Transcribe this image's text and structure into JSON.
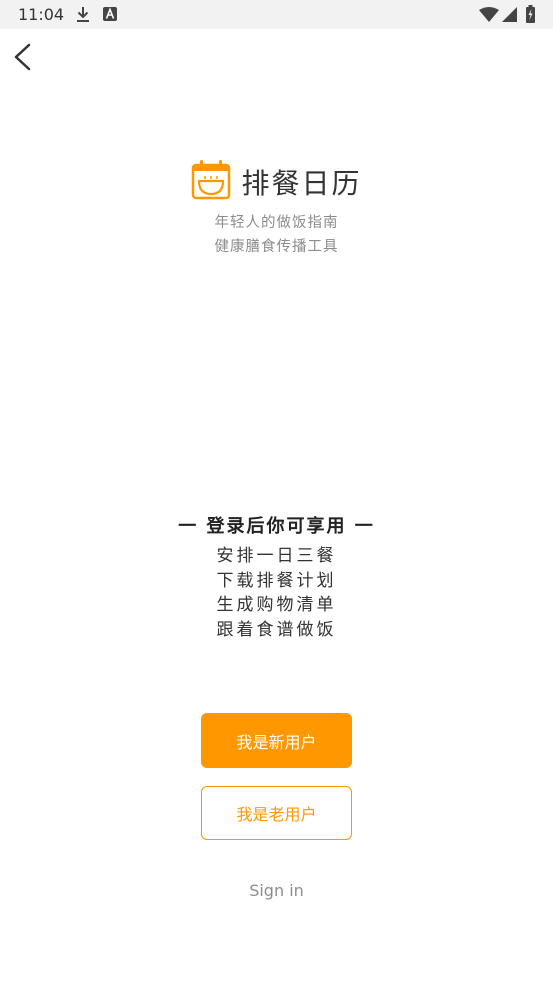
{
  "status_bar": {
    "time": "11:04",
    "left_icons": [
      "download-icon",
      "notification-a-icon"
    ],
    "right_icons": [
      "wifi-icon",
      "signal-icon",
      "battery-icon"
    ]
  },
  "header": {
    "back_icon": "chevron-left-icon"
  },
  "brand": {
    "logo_icon": "calendar-bowl-icon",
    "title": "排餐日历",
    "tagline_1": "年轻人的做饭指南",
    "tagline_2": "健康膳食传播工具"
  },
  "features": {
    "heading": "一 登录后你可享用 一",
    "items": [
      "安排一日三餐",
      "下载排餐计划",
      "生成购物清单",
      "跟着食谱做饭"
    ]
  },
  "actions": {
    "new_user_label": "我是新用户",
    "old_user_label": "我是老用户",
    "sign_in_label": "Sign in"
  },
  "colors": {
    "accent": "#ff9800",
    "muted_text": "#8c8c8c",
    "status_bar_bg": "#f2f2f2"
  }
}
